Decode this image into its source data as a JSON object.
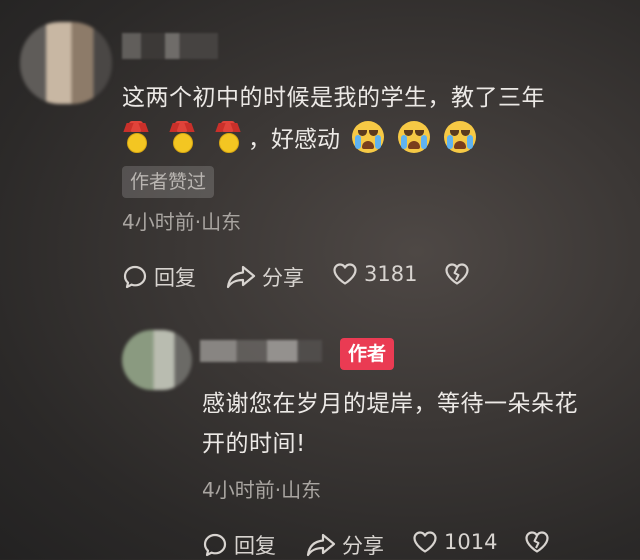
{
  "comment1": {
    "text": "这两个初中的时候是我的学生，教了三年",
    "suffix_text": "，好感动",
    "emoji_medals": [
      "medal-icon",
      "medal-icon",
      "medal-icon"
    ],
    "emoji_cry": [
      "loudly-crying-face-icon",
      "loudly-crying-face-icon",
      "loudly-crying-face-icon"
    ],
    "liked_badge": "作者赞过",
    "meta": "4小时前·山东",
    "reply_label": "回复",
    "share_label": "分享",
    "likes": "3181"
  },
  "comment2": {
    "author_tag": "作者",
    "text_line1": "感谢您在岁月的堤岸，等待一朵朵花",
    "text_line2": "开的时间!",
    "meta": "4小时前·山东",
    "reply_label": "回复",
    "share_label": "分享",
    "likes": "1014"
  },
  "colors": {
    "author_tag": "#ea3b53",
    "text": "#ece9e6",
    "meta": "#a9a5a1"
  }
}
